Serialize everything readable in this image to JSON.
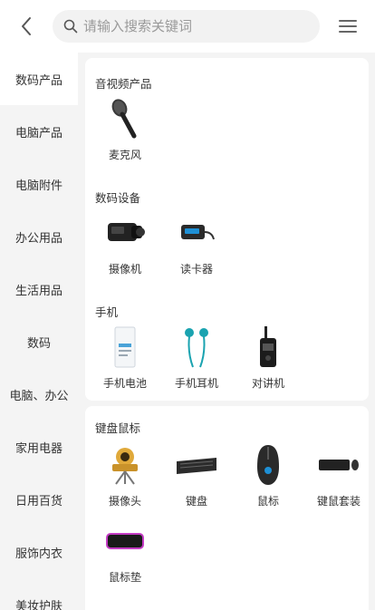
{
  "search": {
    "placeholder": "请输入搜索关键词",
    "value": ""
  },
  "sidebar": {
    "items": [
      {
        "label": "数码产品"
      },
      {
        "label": "电脑产品"
      },
      {
        "label": "电脑附件"
      },
      {
        "label": "办公用品"
      },
      {
        "label": "生活用品"
      },
      {
        "label": "数码"
      },
      {
        "label": "电脑、办公"
      },
      {
        "label": "家用电器"
      },
      {
        "label": "日用百货"
      },
      {
        "label": "服饰内衣"
      },
      {
        "label": "美妆护肤"
      }
    ]
  },
  "sections": [
    {
      "title": "音视频产品",
      "items": [
        {
          "label": "麦克风",
          "icon": "microphone-icon"
        }
      ]
    },
    {
      "title": "数码设备",
      "items": [
        {
          "label": "摄像机",
          "icon": "camcorder-icon"
        },
        {
          "label": "读卡器",
          "icon": "card-reader-icon"
        }
      ]
    },
    {
      "title": "手机",
      "items": [
        {
          "label": "手机电池",
          "icon": "phone-battery-icon"
        },
        {
          "label": "手机耳机",
          "icon": "earphones-icon"
        },
        {
          "label": "对讲机",
          "icon": "walkie-talkie-icon"
        }
      ]
    },
    {
      "title": "键盘鼠标",
      "items": [
        {
          "label": "摄像头",
          "icon": "webcam-icon"
        },
        {
          "label": "键盘",
          "icon": "keyboard-icon"
        },
        {
          "label": "鼠标",
          "icon": "mouse-icon"
        },
        {
          "label": "键鼠套装",
          "icon": "keyboard-mouse-set-icon"
        },
        {
          "label": "鼠标垫",
          "icon": "mouse-pad-icon"
        }
      ]
    }
  ],
  "colors": {
    "header_bg": "#ffffff",
    "sidebar_bg": "#f4f4f4",
    "active_bg": "#ffffff",
    "search_bg": "#f2f2f2"
  }
}
